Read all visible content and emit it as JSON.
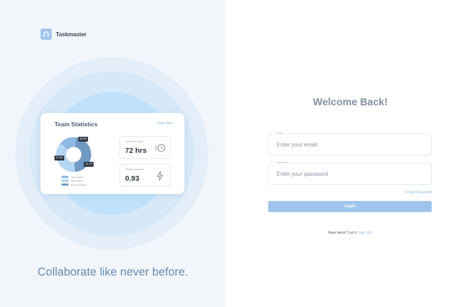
{
  "brand": {
    "name": "Taskmaster"
  },
  "stats_card": {
    "title": "Team Statistics",
    "view_more": "View More",
    "donut": {
      "labels": [
        "46.5%",
        "37.5%",
        "16.1%"
      ],
      "colors": [
        "#6f9ac3",
        "#b5d6f2",
        "#8db8e4"
      ]
    },
    "legend": [
      {
        "label": "Stacy Jordan",
        "color": "#8db8e4"
      },
      {
        "label": "Ben Landers",
        "color": "#b5d6f2"
      },
      {
        "label": "Nora Fernandes",
        "color": "#6f9ac3"
      }
    ],
    "stats": [
      {
        "label": "Total Time Spent",
        "value": "72 hrs",
        "icon": "clock-speed-icon"
      },
      {
        "label": "Efficient Workflow",
        "value": "0.93",
        "icon": "lightning-icon"
      }
    ]
  },
  "tagline": "Collaborate like never before.",
  "login": {
    "title": "Welcome Back!",
    "email_label": "Email",
    "email_placeholder": "Enter your email",
    "password_label": "Password",
    "password_placeholder": "Enter your password",
    "forgot": "Forgot Password",
    "button": "Login",
    "signup_prompt": "New Here? Let's",
    "signup_link": "Sign Up!"
  },
  "colors": {
    "accent": "#9fc5ec",
    "link": "#8fb6df",
    "panel_bg": "#f2f5f9",
    "tagline": "#6a8db4"
  }
}
